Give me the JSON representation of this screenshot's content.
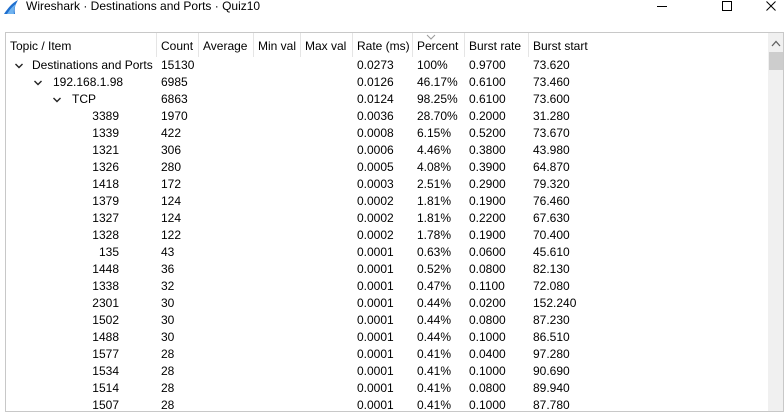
{
  "window": {
    "title": "Wireshark · Destinations and Ports · Quiz10",
    "minimize_glyph": "—",
    "maximize_glyph": "☐",
    "close_glyph": "✕"
  },
  "columns": [
    "Topic / Item",
    "Count",
    "Average",
    "Min val",
    "Max val",
    "Rate (ms)",
    "Percent",
    "Burst rate",
    "Burst start"
  ],
  "rows": [
    {
      "topic": "Destinations and Ports",
      "count": "15130",
      "rate": "0.0273",
      "percent": "100%",
      "burst_rate": "0.9700",
      "burst_start": "73.620"
    },
    {
      "topic": "192.168.1.98",
      "count": "6985",
      "rate": "0.0126",
      "percent": "46.17%",
      "burst_rate": "0.6100",
      "burst_start": "73.460"
    },
    {
      "topic": "TCP",
      "count": "6863",
      "rate": "0.0124",
      "percent": "98.25%",
      "burst_rate": "0.6100",
      "burst_start": "73.600"
    },
    {
      "topic": "3389",
      "count": "1970",
      "rate": "0.0036",
      "percent": "28.70%",
      "burst_rate": "0.2000",
      "burst_start": "31.280"
    },
    {
      "topic": "1339",
      "count": "422",
      "rate": "0.0008",
      "percent": "6.15%",
      "burst_rate": "0.5200",
      "burst_start": "73.670"
    },
    {
      "topic": "1321",
      "count": "306",
      "rate": "0.0006",
      "percent": "4.46%",
      "burst_rate": "0.3800",
      "burst_start": "43.980"
    },
    {
      "topic": "1326",
      "count": "280",
      "rate": "0.0005",
      "percent": "4.08%",
      "burst_rate": "0.3900",
      "burst_start": "64.870"
    },
    {
      "topic": "1418",
      "count": "172",
      "rate": "0.0003",
      "percent": "2.51%",
      "burst_rate": "0.2900",
      "burst_start": "79.320"
    },
    {
      "topic": "1379",
      "count": "124",
      "rate": "0.0002",
      "percent": "1.81%",
      "burst_rate": "0.1900",
      "burst_start": "76.460"
    },
    {
      "topic": "1327",
      "count": "124",
      "rate": "0.0002",
      "percent": "1.81%",
      "burst_rate": "0.2200",
      "burst_start": "67.630"
    },
    {
      "topic": "1328",
      "count": "122",
      "rate": "0.0002",
      "percent": "1.78%",
      "burst_rate": "0.1900",
      "burst_start": "70.400"
    },
    {
      "topic": "135",
      "count": "43",
      "rate": "0.0001",
      "percent": "0.63%",
      "burst_rate": "0.0600",
      "burst_start": "45.610"
    },
    {
      "topic": "1448",
      "count": "36",
      "rate": "0.0001",
      "percent": "0.52%",
      "burst_rate": "0.0800",
      "burst_start": "82.130"
    },
    {
      "topic": "1338",
      "count": "32",
      "rate": "0.0001",
      "percent": "0.47%",
      "burst_rate": "0.1100",
      "burst_start": "72.080"
    },
    {
      "topic": "2301",
      "count": "30",
      "rate": "0.0001",
      "percent": "0.44%",
      "burst_rate": "0.0200",
      "burst_start": "152.240"
    },
    {
      "topic": "1502",
      "count": "30",
      "rate": "0.0001",
      "percent": "0.44%",
      "burst_rate": "0.0800",
      "burst_start": "87.230"
    },
    {
      "topic": "1488",
      "count": "30",
      "rate": "0.0001",
      "percent": "0.44%",
      "burst_rate": "0.1000",
      "burst_start": "86.510"
    },
    {
      "topic": "1577",
      "count": "28",
      "rate": "0.0001",
      "percent": "0.41%",
      "burst_rate": "0.0400",
      "burst_start": "97.280"
    },
    {
      "topic": "1534",
      "count": "28",
      "rate": "0.0001",
      "percent": "0.41%",
      "burst_rate": "0.1000",
      "burst_start": "90.690"
    },
    {
      "topic": "1514",
      "count": "28",
      "rate": "0.0001",
      "percent": "0.41%",
      "burst_rate": "0.0800",
      "burst_start": "89.940"
    },
    {
      "topic": "1507",
      "count": "28",
      "rate": "0.0001",
      "percent": "0.41%",
      "burst_rate": "0.1000",
      "burst_start": "87.780"
    }
  ],
  "colors": {
    "icon_blue": "#1e6fcf",
    "icon_light": "#6fb3f0",
    "scroll_track": "#f0f0f0",
    "scroll_thumb": "#cdcdcd"
  }
}
